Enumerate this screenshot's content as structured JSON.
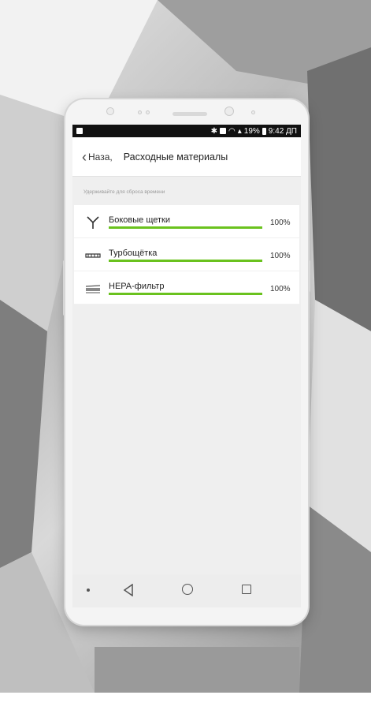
{
  "status_bar": {
    "battery_percent": "19%",
    "time": "9:42 ДП"
  },
  "top_bar": {
    "back_label": "Наза,",
    "title": "Расходные материалы"
  },
  "hint": "Удерживайте для сброса времени",
  "consumables": [
    {
      "name": "Боковые щетки",
      "percent_label": "100%",
      "level": 1.0,
      "icon": "side-brush-icon"
    },
    {
      "name": "Турбощётка",
      "percent_label": "100%",
      "level": 1.0,
      "icon": "turbo-brush-icon"
    },
    {
      "name": "HEPA-фильтр",
      "percent_label": "100%",
      "level": 1.0,
      "icon": "hepa-filter-icon"
    }
  ],
  "colors": {
    "progress": "#6ac21e",
    "status_bar": "#111111"
  }
}
